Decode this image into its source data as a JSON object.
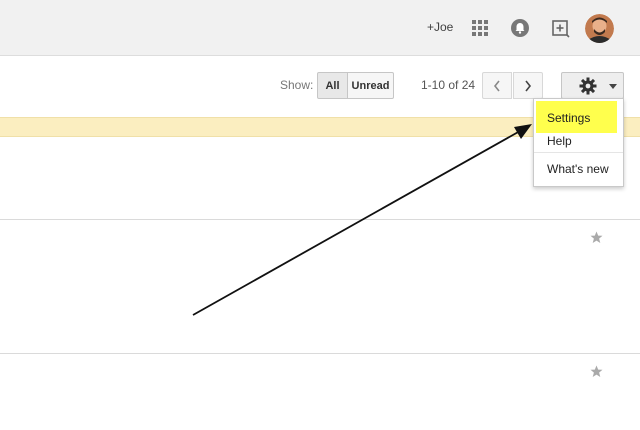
{
  "header": {
    "user_link": "+Joe",
    "icons": [
      "apps-grid-icon",
      "notifications-bell-icon",
      "share-plus-icon",
      "avatar"
    ]
  },
  "toolbar": {
    "show_label": "Show:",
    "filter_all": "All",
    "filter_unread": "Unread",
    "pager": "1-10 of 24",
    "icons": [
      "chevron-left-icon",
      "chevron-right-icon",
      "gear-icon",
      "caret-down-icon"
    ]
  },
  "settings_menu": {
    "items": [
      "Settings",
      "Help",
      "What's new"
    ],
    "highlighted_item": "Settings",
    "highlight_color": "#ffff4d"
  },
  "rows": [
    {
      "starred": false
    },
    {
      "starred": false
    }
  ],
  "colors": {
    "topbar_bg": "#f1f1f1",
    "banner_bg": "#fbeec0",
    "highlight": "#ffff4d"
  }
}
